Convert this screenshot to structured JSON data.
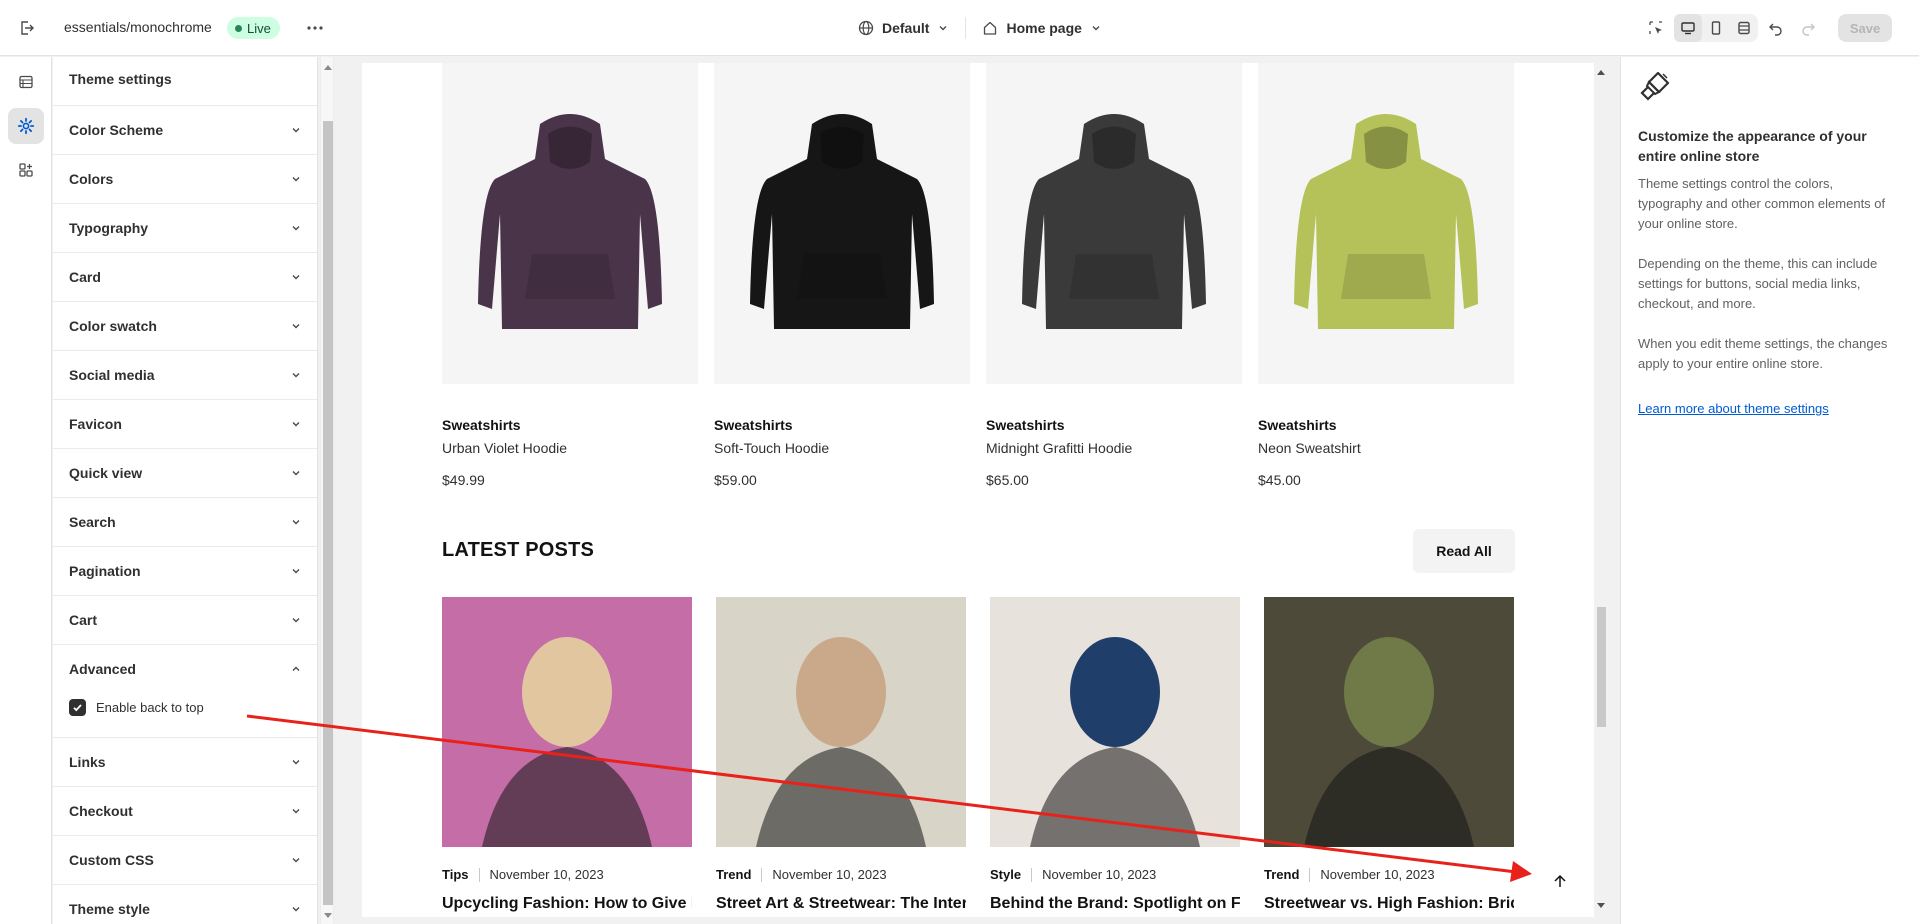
{
  "topbar": {
    "store_name": "essentials/monochrome",
    "status_badge": "Live",
    "theme_dropdown": "Default",
    "page_dropdown": "Home page",
    "save_label": "Save"
  },
  "panel": {
    "title": "Theme settings",
    "sections": [
      {
        "label": "Color Scheme",
        "expanded": false
      },
      {
        "label": "Colors",
        "expanded": false
      },
      {
        "label": "Typography",
        "expanded": false
      },
      {
        "label": "Card",
        "expanded": false
      },
      {
        "label": "Color swatch",
        "expanded": false
      },
      {
        "label": "Social media",
        "expanded": false
      },
      {
        "label": "Favicon",
        "expanded": false
      },
      {
        "label": "Quick view",
        "expanded": false
      },
      {
        "label": "Search",
        "expanded": false
      },
      {
        "label": "Pagination",
        "expanded": false
      },
      {
        "label": "Cart",
        "expanded": false
      },
      {
        "label": "Advanced",
        "expanded": true
      },
      {
        "label": "Links",
        "expanded": false
      },
      {
        "label": "Checkout",
        "expanded": false
      },
      {
        "label": "Custom CSS",
        "expanded": false
      },
      {
        "label": "Theme style",
        "expanded": false
      }
    ],
    "advanced_option": {
      "label": "Enable back to top",
      "checked": true
    }
  },
  "preview": {
    "products": [
      {
        "category": "Sweatshirts",
        "name": "Urban Violet Hoodie",
        "price": "$49.99",
        "color": "#4a3449"
      },
      {
        "category": "Sweatshirts",
        "name": "Soft-Touch Hoodie",
        "price": "$59.00",
        "color": "#161616"
      },
      {
        "category": "Sweatshirts",
        "name": "Midnight Grafitti Hoodie",
        "price": "$65.00",
        "color": "#3a3a3a"
      },
      {
        "category": "Sweatshirts",
        "name": "Neon Sweatshirt",
        "price": "$45.00",
        "color": "#b5c25a"
      }
    ],
    "posts_heading": "LATEST POSTS",
    "read_all_label": "Read All",
    "posts": [
      {
        "tag": "Tips",
        "date": "November 10, 2023",
        "title": "Upcycling Fashion: How to Give New Life to Old Clothes"
      },
      {
        "tag": "Trend",
        "date": "November 10, 2023",
        "title": "Street Art & Streetwear: The Intersection of Artistic Expression"
      },
      {
        "tag": "Style",
        "date": "November 10, 2023",
        "title": "Behind the Brand: Spotlight on Fashion Designers Making Waves"
      },
      {
        "tag": "Trend",
        "date": "November 10, 2023",
        "title": "Streetwear vs. High Fashion: Bridging the Gap with Urban Style"
      }
    ]
  },
  "info": {
    "heading": "Customize the appearance of your entire online store",
    "paragraph_1": "Theme settings control the colors, typography and other common elements of your online store.",
    "paragraph_2": "Depending on the theme, this can include settings for buttons, social media links, checkout, and more.",
    "paragraph_3": "When you edit theme settings, the changes apply to your entire online store.",
    "link": "Learn more about theme settings"
  },
  "colors": {
    "accent_link": "#005bd3",
    "live_badge_bg": "#cdfee1",
    "annotation_arrow": "#e8221b"
  }
}
